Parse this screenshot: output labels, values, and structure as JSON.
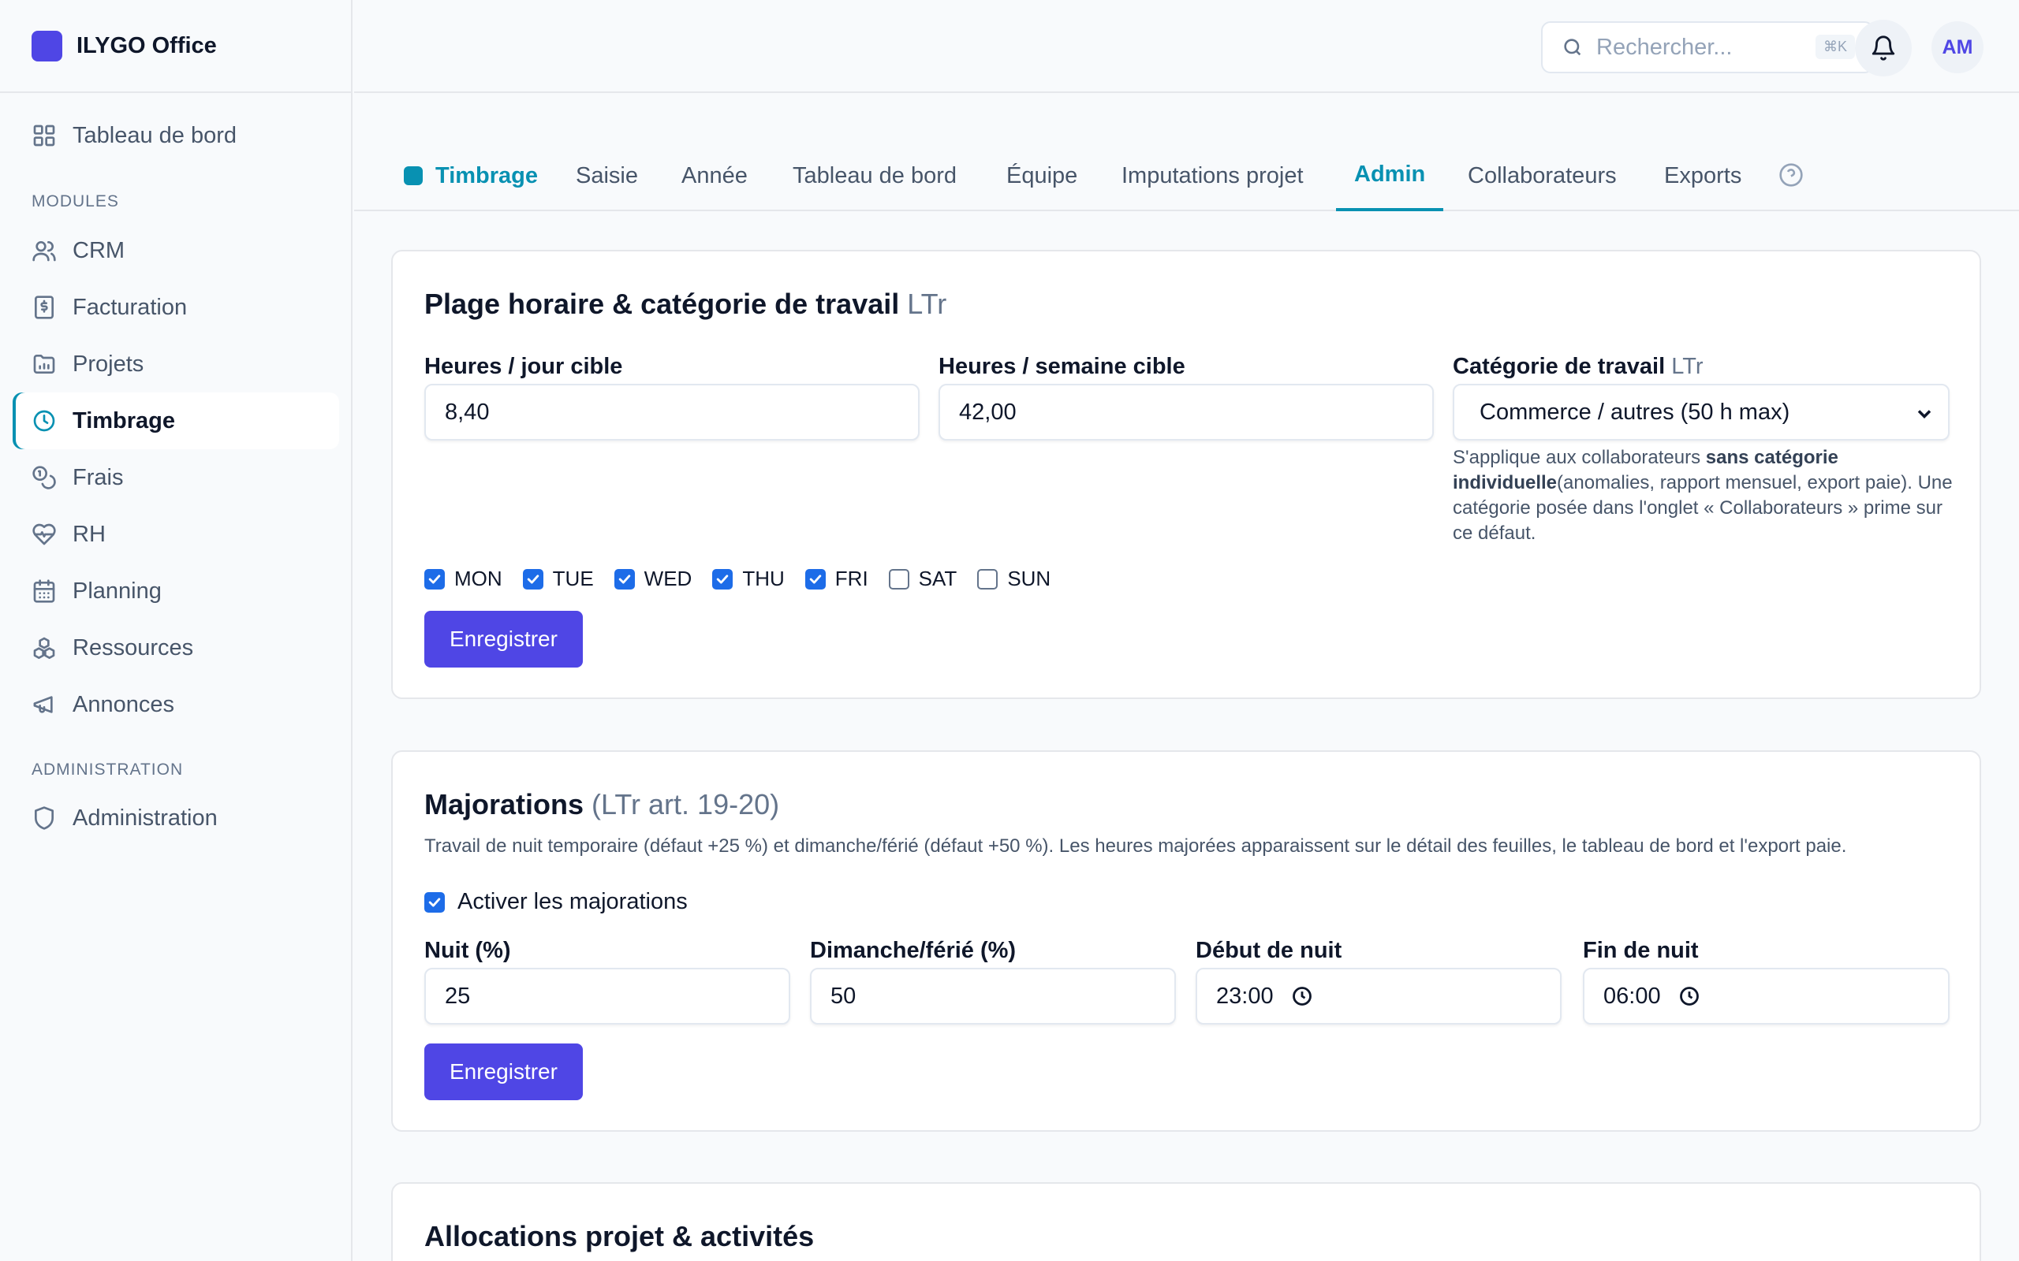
{
  "app": {
    "name": "ILYGO Office"
  },
  "sidebar": {
    "dashboard": "Tableau de bord",
    "modules_label": "MODULES",
    "items": [
      {
        "label": "CRM",
        "icon": "users-icon"
      },
      {
        "label": "Facturation",
        "icon": "invoice-icon"
      },
      {
        "label": "Projets",
        "icon": "folder-icon"
      },
      {
        "label": "Timbrage",
        "icon": "clock-icon"
      },
      {
        "label": "Frais",
        "icon": "coins-icon"
      },
      {
        "label": "RH",
        "icon": "heart-pulse-icon"
      },
      {
        "label": "Planning",
        "icon": "calendar-icon"
      },
      {
        "label": "Ressources",
        "icon": "boxes-icon"
      },
      {
        "label": "Annonces",
        "icon": "megaphone-icon"
      }
    ],
    "admin_label": "ADMINISTRATION",
    "administration": "Administration"
  },
  "topbar": {
    "search_placeholder": "Rechercher...",
    "search_shortcut": "⌘K",
    "avatar_initials": "AM"
  },
  "tabs": {
    "module": "Timbrage",
    "items": [
      "Saisie",
      "Année",
      "Tableau de bord",
      "Équipe",
      "Imputations projet",
      "Admin",
      "Collaborateurs",
      "Exports"
    ],
    "active": "Admin"
  },
  "plage": {
    "title": "Plage horaire & catégorie de travail",
    "title_suffix": "LTr",
    "hours_day_label": "Heures / jour cible",
    "hours_day_value": "8,40",
    "hours_week_label": "Heures / semaine cible",
    "hours_week_value": "42,00",
    "category_label": "Catégorie de travail",
    "category_suffix": "LTr",
    "category_value": "Commerce / autres (50 h max)",
    "hint_1": "S'applique aux collaborateurs ",
    "hint_bold": "sans catégorie individuelle",
    "hint_2": "(anomalies, rapport mensuel, export paie). Une catégorie posée dans l'onglet « Collaborateurs » prime sur ce défaut.",
    "days": [
      {
        "label": "MON",
        "checked": true
      },
      {
        "label": "TUE",
        "checked": true
      },
      {
        "label": "WED",
        "checked": true
      },
      {
        "label": "THU",
        "checked": true
      },
      {
        "label": "FRI",
        "checked": true
      },
      {
        "label": "SAT",
        "checked": false
      },
      {
        "label": "SUN",
        "checked": false
      }
    ],
    "save": "Enregistrer"
  },
  "majorations": {
    "title": "Majorations",
    "title_suffix": "(LTr art. 19-20)",
    "description": "Travail de nuit temporaire (défaut +25 %) et dimanche/férié (défaut +50 %). Les heures majorées apparaissent sur le détail des feuilles, le tableau de bord et l'export paie.",
    "enable_label": "Activer les majorations",
    "enable_checked": true,
    "night_label": "Nuit (%)",
    "night_value": "25",
    "sunday_label": "Dimanche/férié (%)",
    "sunday_value": "50",
    "night_start_label": "Début de nuit",
    "night_start_value": "23:00",
    "night_end_label": "Fin de nuit",
    "night_end_value": "06:00",
    "save": "Enregistrer"
  },
  "allocations": {
    "title": "Allocations projet & activités"
  },
  "colors": {
    "accent": "#0891b2",
    "primary": "#4f46e5",
    "checkbox": "#1d6ce8"
  }
}
